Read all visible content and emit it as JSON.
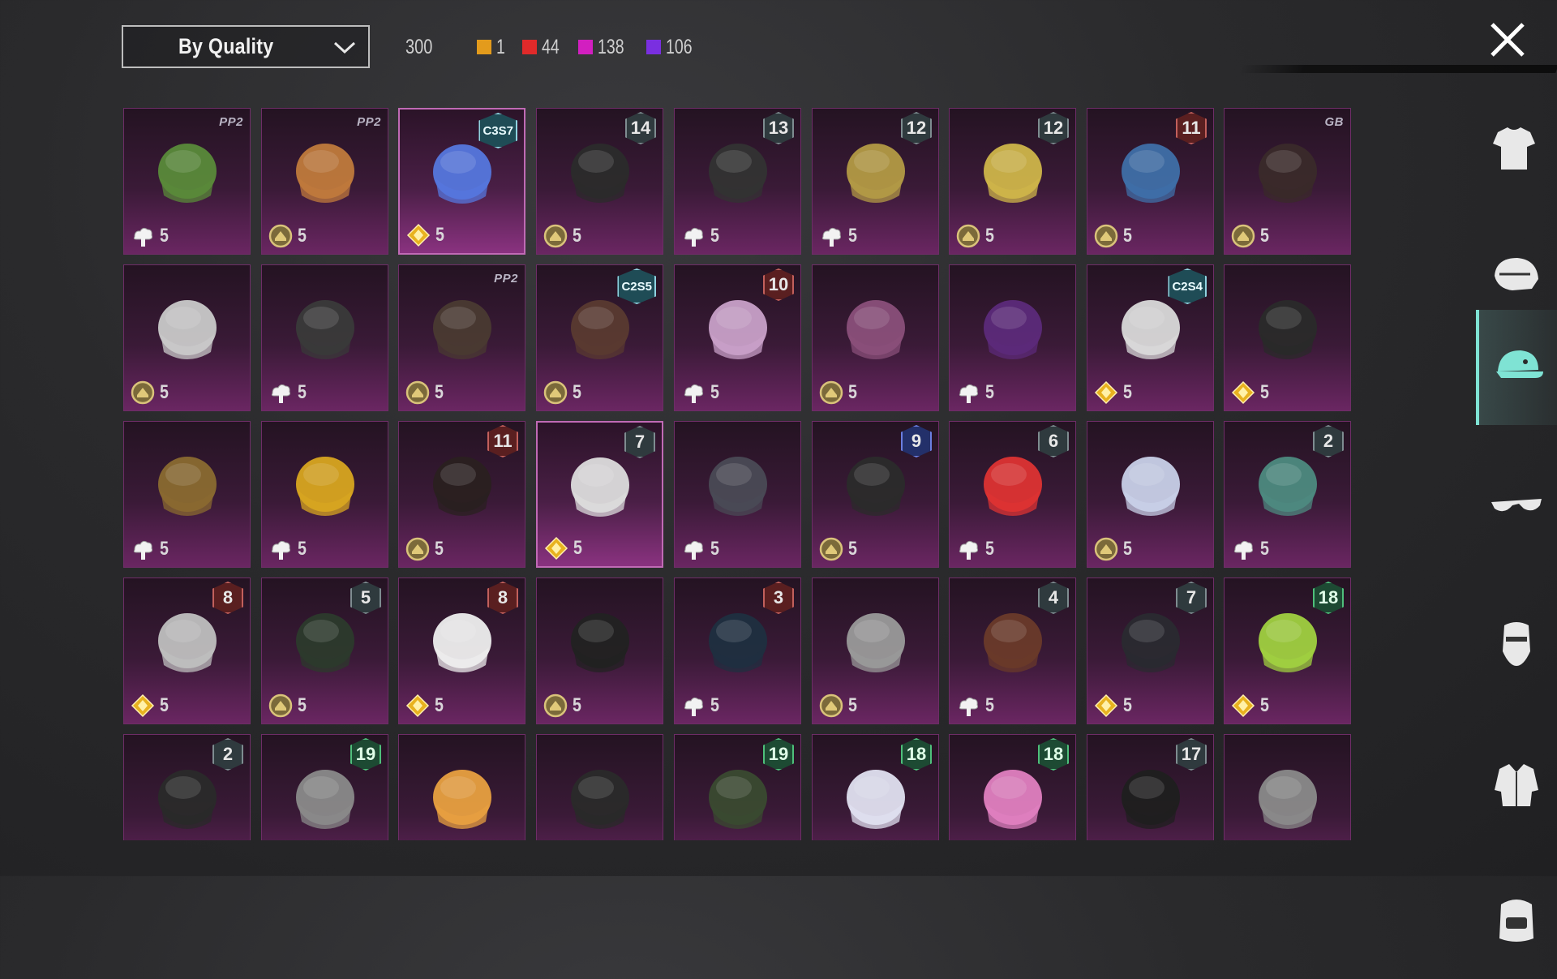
{
  "filter": {
    "sort_label": "By Quality",
    "total": "300"
  },
  "quality_counts": [
    {
      "color": "#e39b1c",
      "count": "1"
    },
    {
      "color": "#e02a2a",
      "count": "44"
    },
    {
      "color": "#d21fc0",
      "count": "138"
    },
    {
      "color": "#7a2fe0",
      "count": "106"
    }
  ],
  "items": [
    {
      "name": "octopus-mask-icon",
      "cur": "cloud",
      "count": "5",
      "tag": "PP2"
    },
    {
      "name": "cobra-helmet-icon",
      "cur": "coin",
      "count": "5",
      "tag": "PP2"
    },
    {
      "name": "blue-fairy-hat-icon",
      "cur": "diamond",
      "count": "5",
      "badge": "C3S7",
      "bt": "season",
      "selected": true
    },
    {
      "name": "headband-hair-icon",
      "cur": "coin",
      "count": "5",
      "badge": "14",
      "bt": "grey"
    },
    {
      "name": "horned-cap-icon",
      "cur": "cloud",
      "count": "5",
      "badge": "13",
      "bt": "grey"
    },
    {
      "name": "toy-head-icon",
      "cur": "cloud",
      "count": "5",
      "badge": "12",
      "bt": "grey"
    },
    {
      "name": "robot-mask-icon",
      "cur": "coin",
      "count": "5",
      "badge": "12",
      "bt": "grey"
    },
    {
      "name": "blue-beanie-icon",
      "cur": "coin",
      "count": "5",
      "badge": "11",
      "bt": "red"
    },
    {
      "name": "long-hair-hat-icon",
      "cur": "coin",
      "count": "5",
      "tag": "GB"
    },
    {
      "name": "silver-hood-icon",
      "cur": "coin",
      "count": "5"
    },
    {
      "name": "dark-knight-mask-icon",
      "cur": "cloud",
      "count": "5"
    },
    {
      "name": "gas-mask-icon",
      "cur": "coin",
      "count": "5",
      "tag": "PP2"
    },
    {
      "name": "brown-hair-icon",
      "cur": "coin",
      "count": "5",
      "badge": "C2S5",
      "bt": "season"
    },
    {
      "name": "pink-helmet-icon",
      "cur": "cloud",
      "count": "5",
      "badge": "10",
      "bt": "red"
    },
    {
      "name": "medusa-hat-icon",
      "cur": "coin",
      "count": "5"
    },
    {
      "name": "green-ghost-mask-icon",
      "cur": "cloud",
      "count": "5"
    },
    {
      "name": "white-wig-icon",
      "cur": "diamond",
      "count": "5",
      "badge": "C2S4",
      "bt": "season"
    },
    {
      "name": "top-hat-hair-icon",
      "cur": "diamond",
      "count": "5"
    },
    {
      "name": "pirate-hat-icon",
      "cur": "cloud",
      "count": "5"
    },
    {
      "name": "yellow-helmet-icon",
      "cur": "cloud",
      "count": "5"
    },
    {
      "name": "black-hair-bow-icon",
      "cur": "coin",
      "count": "5",
      "badge": "11",
      "bt": "red"
    },
    {
      "name": "genie-hat-icon",
      "cur": "diamond",
      "count": "5",
      "badge": "7",
      "bt": "grey",
      "selected": true
    },
    {
      "name": "visor-helmet-icon",
      "cur": "cloud",
      "count": "5"
    },
    {
      "name": "dark-cap-icon",
      "cur": "coin",
      "count": "5",
      "badge": "9",
      "bt": "blue"
    },
    {
      "name": "santa-hat-icon",
      "cur": "cloud",
      "count": "5",
      "badge": "6",
      "bt": "grey"
    },
    {
      "name": "ice-crown-icon",
      "cur": "coin",
      "count": "5"
    },
    {
      "name": "jade-helmet-icon",
      "cur": "cloud",
      "count": "5",
      "badge": "2",
      "bt": "grey"
    },
    {
      "name": "mech-helmet-icon",
      "cur": "diamond",
      "count": "5",
      "badge": "8",
      "bt": "red"
    },
    {
      "name": "wizard-hat-icon",
      "cur": "coin",
      "count": "5",
      "badge": "5",
      "bt": "grey"
    },
    {
      "name": "white-hat-icon",
      "cur": "diamond",
      "count": "5",
      "badge": "8",
      "bt": "red"
    },
    {
      "name": "kendo-mask-icon",
      "cur": "coin",
      "count": "5"
    },
    {
      "name": "ninja-hat-icon",
      "cur": "cloud",
      "count": "5",
      "badge": "3",
      "bt": "red"
    },
    {
      "name": "grey-hair-icon",
      "cur": "coin",
      "count": "5"
    },
    {
      "name": "oni-mask-icon",
      "cur": "cloud",
      "count": "5",
      "badge": "4",
      "bt": "grey"
    },
    {
      "name": "officer-cap-icon",
      "cur": "diamond",
      "count": "5",
      "badge": "7",
      "bt": "grey"
    },
    {
      "name": "green-cap-icon",
      "cur": "diamond",
      "count": "5",
      "badge": "18",
      "bt": "green"
    },
    {
      "name": "dread-hood-icon",
      "cur": "",
      "count": "",
      "badge": "2",
      "bt": "grey"
    },
    {
      "name": "cat-ear-hair-icon",
      "cur": "",
      "count": "",
      "badge": "19",
      "bt": "green"
    },
    {
      "name": "fox-helmet-icon",
      "cur": "",
      "count": ""
    },
    {
      "name": "top-knot-icon",
      "cur": "",
      "count": ""
    },
    {
      "name": "goggle-helmet-icon",
      "cur": "",
      "count": "",
      "badge": "19",
      "bt": "green"
    },
    {
      "name": "headphone-cap-icon",
      "cur": "",
      "count": "",
      "badge": "18",
      "bt": "green"
    },
    {
      "name": "pink-headphone-cap-icon",
      "cur": "",
      "count": "",
      "badge": "18",
      "bt": "green"
    },
    {
      "name": "black-hood-icon",
      "cur": "",
      "count": "",
      "badge": "17",
      "bt": "grey"
    },
    {
      "name": "lion-mask-icon",
      "cur": "",
      "count": ""
    }
  ],
  "sidebar": [
    {
      "name": "outfit-icon"
    },
    {
      "name": "mask-icon"
    },
    {
      "name": "cap-icon",
      "active": true
    },
    {
      "name": "glasses-icon"
    },
    {
      "name": "face-icon"
    },
    {
      "name": "jacket-icon"
    },
    {
      "name": "backpack-icon"
    }
  ]
}
